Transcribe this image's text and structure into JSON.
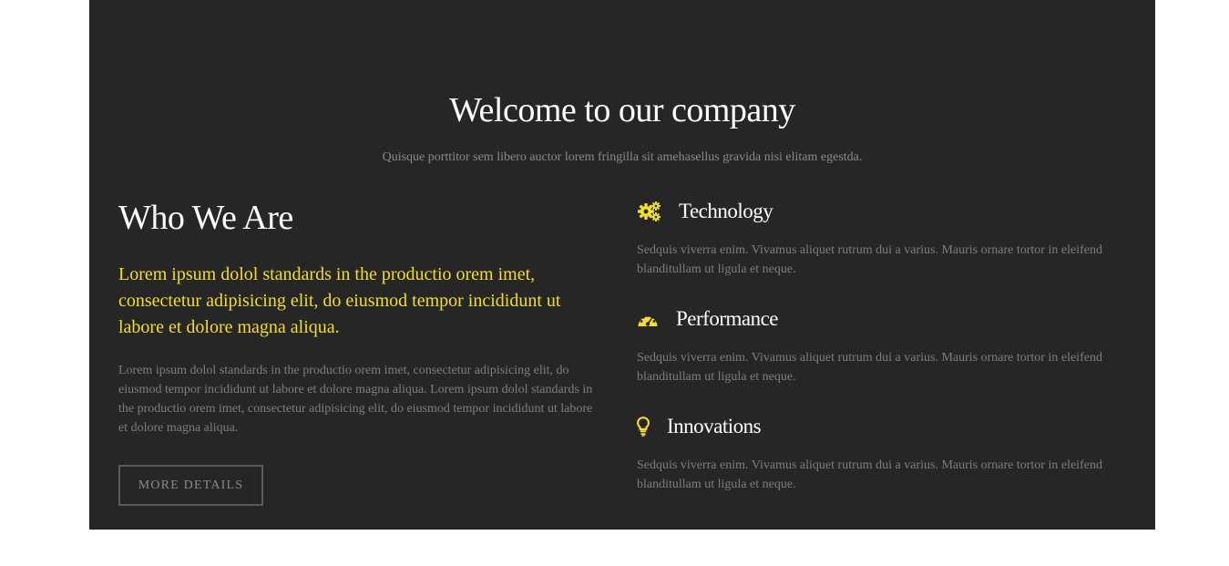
{
  "header": {
    "title": "Welcome to our company",
    "subtitle": "Quisque porttitor sem libero auctor lorem fringilla sit amehasellus gravida nisi elitam egestda."
  },
  "about": {
    "heading": "Who We Are",
    "lead": "Lorem ipsum dolol standards in the productio orem imet, consectetur adipisicing elit, do eiusmod tempor incididunt ut labore et dolore magna aliqua.",
    "body": "Lorem ipsum dolol standards in the productio orem imet, consectetur adipisicing elit, do eiusmod tempor incididunt ut labore et dolore magna aliqua. Lorem ipsum dolol standards in the productio orem imet, consectetur adipisicing elit, do eiusmod tempor incididunt ut labore et dolore magna aliqua.",
    "button_label": "MORE DETAILS"
  },
  "features": [
    {
      "icon": "gears-icon",
      "title": "Technology",
      "text": "Sedquis viverra enim. Vivamus aliquet rutrum dui a varius. Mauris ornare tortor in eleifend blanditullam ut ligula et neque."
    },
    {
      "icon": "dashboard-icon",
      "title": "Performance",
      "text": "Sedquis viverra enim. Vivamus aliquet rutrum dui a varius. Mauris ornare tortor in eleifend blanditullam ut ligula et neque."
    },
    {
      "icon": "lightbulb-icon",
      "title": "Innovations",
      "text": "Sedquis viverra enim. Vivamus aliquet rutrum dui a varius. Mauris ornare tortor in eleifend blanditullam ut ligula et neque."
    }
  ],
  "colors": {
    "panel_background": "#262626",
    "accent": "#f5dd2c",
    "heading": "#ffffff",
    "muted_text": "#7d7d7d"
  }
}
